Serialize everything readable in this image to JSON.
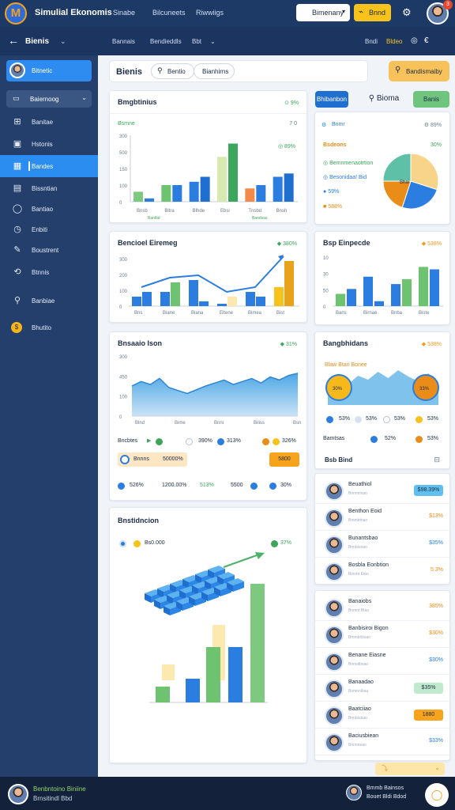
{
  "topbar": {
    "app_title": "Simulial Ekonomis",
    "nav": [
      "Sinabe",
      "Bilcuneets",
      "Riwwiigs"
    ],
    "select_label": "Bimenany",
    "button_label": "Bnnd",
    "notification_count": "3"
  },
  "subbar": {
    "sidebar_title": "Bienis",
    "nav": [
      "Bannais",
      "Bendieddls",
      "Bbt"
    ],
    "right_items": [
      "Bndi",
      "Bldeo",
      "€"
    ]
  },
  "sidebar": {
    "user_label": "Bitnetic",
    "select_label": "Baiernoog",
    "items": [
      {
        "icon": "square-plus-icon",
        "label": "Banitae"
      },
      {
        "icon": "calendar-icon",
        "label": "Hstonis"
      },
      {
        "icon": "chart-icon",
        "label": "Bandes",
        "active": true
      },
      {
        "icon": "document-icon",
        "label": "Bissntian"
      },
      {
        "icon": "circle-icon",
        "label": "Bantiao"
      },
      {
        "icon": "clock-icon",
        "label": "Enbiti"
      },
      {
        "icon": "edit-icon",
        "label": "Boustrent"
      },
      {
        "icon": "support-icon",
        "label": "Btnnis"
      },
      {
        "icon": "user-icon",
        "label": "Banbiae"
      },
      {
        "icon": "dollar-icon",
        "label": "Bhutito"
      }
    ]
  },
  "search": {
    "title": "Bienis",
    "pill1": "Bentio",
    "pill2": "Bianhirns",
    "button": "Bandismaiby"
  },
  "cards": {
    "c1": {
      "title": "Bmgbtinius",
      "badge": "9%",
      "row_left": "Bsmne",
      "row_right": "7 0",
      "badge2": "89%",
      "yticks": [
        "300",
        "500",
        "150",
        "100",
        "0"
      ],
      "xticks": [
        "Bnsb",
        "Bitra",
        "Blhde",
        "Ebsi",
        "Tnsbd",
        "Bnsh"
      ],
      "xsub": [
        "Banibd",
        "Bandsas"
      ]
    },
    "c2": {
      "title": "Bencioel Eiremeg",
      "badge": "380%",
      "yticks": [
        "300",
        "200",
        "100",
        "0"
      ],
      "xticks": [
        "Bns",
        "Biane",
        "Biana",
        "Eltene",
        "Bimea",
        "Bist"
      ]
    },
    "c3": {
      "title": "Bnsaaio Ison",
      "badge": "31%",
      "yticks": [
        "300",
        "450",
        "100",
        "0"
      ],
      "xticks": [
        "Blnd",
        "Bime",
        "Bnni",
        "Biliss",
        "Bsn"
      ],
      "legend1": [
        "Bncbtes",
        "390%",
        "313%",
        "326%"
      ],
      "btn1": "Bnnns",
      "btn1b": "50000%",
      "btn2": "5800",
      "legend2": [
        "526%",
        "1200.00%",
        "513%",
        "5500",
        "30%"
      ]
    },
    "c4": {
      "title": "Bnstidncion",
      "legend": [
        "Bs0.000",
        "37%"
      ]
    },
    "r0": {
      "tabs": [
        "Bhibanbon",
        "Bioma",
        "Banis"
      ]
    },
    "r1": {
      "subtitle": "Bnmr",
      "right": "89%",
      "legend": [
        [
          "Bsdeons",
          "30%"
        ],
        [
          "Bemnmenaotrtion",
          ""
        ],
        [
          "Besonidaa! Bid",
          ""
        ],
        [
          "59%",
          ""
        ],
        [
          "588%",
          ""
        ]
      ],
      "pie_label": "Bhai"
    },
    "r2": {
      "title": "Bsp Einpecde",
      "badge": "538%",
      "yticks": [
        "10",
        "30",
        "50",
        "0"
      ],
      "xticks": [
        "Bans",
        "Birnae",
        "Bnba",
        "Biste"
      ]
    },
    "r3": {
      "title": "Bangbhidans",
      "badge": "538%",
      "subtitle": "Blaw Btan Bonee",
      "l1": [
        "53%",
        "53%",
        "53%"
      ],
      "l2": [
        "Bamtsas",
        "52%",
        "53%"
      ]
    },
    "r4": {
      "header": "Bsb Bind"
    }
  },
  "people1": [
    {
      "name": "Beuathiol",
      "sub": "Bnnnninao",
      "value": "$98.39%",
      "style": "pill-blue"
    },
    {
      "name": "Benthon Eoid",
      "sub": "Bmmbtnao",
      "value": "$13%",
      "style": "orange"
    },
    {
      "name": "Bunantsbao",
      "sub": "Bnnbtsnao",
      "value": "$35%",
      "style": "blue"
    },
    {
      "name": "Bosbla Eonbtion",
      "sub": "Binnbt Etao",
      "value": "5.3%",
      "style": "orange"
    }
  ],
  "people2": [
    {
      "name": "Banaiobs",
      "sub": "Bomnt Btao",
      "value": "385%",
      "style": "orange"
    },
    {
      "name": "Banbisiroi Bigon",
      "sub": "Bmmbhbsao",
      "value": "$30%",
      "style": "orange"
    },
    {
      "name": "Benane Eiasne",
      "sub": "Bnnoitbsao",
      "value": "$30%",
      "style": "blue"
    },
    {
      "name": "Banaadao",
      "sub": "Bomnnibau",
      "value": "$35%",
      "style": "pill-green"
    },
    {
      "name": "Baatciiao",
      "sub": "Bnnbtsbao",
      "value": "1880",
      "style": "pill-orange"
    },
    {
      "name": "Baciusbiean",
      "sub": "Bnnnneao",
      "value": "$33%",
      "style": "blue"
    }
  ],
  "bottombar": {
    "user_line1": "Benbntoino Biniine",
    "user_line2": "Brnsitindl Bbd",
    "right_line1": "Bmmb Bainsos",
    "right_line2": "Bouet Bldi Bdod"
  },
  "chart_data": [
    {
      "type": "bar",
      "title": "Bmgbtinius",
      "categories": [
        "Bnsb",
        "Bitra",
        "Blhde",
        "Ebsi",
        "Tnsbd",
        "Bnsh"
      ],
      "series": [
        {
          "values": [
            60,
            100,
            120,
            270,
            80,
            150
          ]
        },
        {
          "values": [
            20,
            100,
            150,
            350,
            100,
            170
          ]
        }
      ],
      "ylim": [
        0,
        400
      ]
    },
    {
      "type": "bar",
      "title": "Bencioel Eiremeg",
      "categories": [
        "Bns",
        "Biane",
        "Biana",
        "Eltene",
        "Bimea",
        "Bist"
      ],
      "series": [
        {
          "values": [
            40,
            60,
            110,
            10,
            60,
            80
          ]
        },
        {
          "values": [
            60,
            100,
            20,
            40,
            40,
            190
          ]
        }
      ],
      "ylim": [
        0,
        200
      ]
    },
    {
      "type": "area",
      "title": "Bnsaaio Ison",
      "x": [
        "Blnd",
        "Bime",
        "Bnni",
        "Biliss",
        "Bsn"
      ],
      "y": [
        180,
        240,
        170,
        220,
        280
      ],
      "ylim": [
        0,
        400
      ]
    },
    {
      "type": "pie",
      "values": [
        30,
        25,
        20,
        25
      ]
    },
    {
      "type": "bar",
      "title": "Bsp Einpecde",
      "categories": [
        "Bans",
        "Birnae",
        "Bnba",
        "Biste"
      ],
      "series": [
        {
          "values": [
            25,
            60,
            45,
            80
          ]
        },
        {
          "values": [
            35,
            10,
            55,
            75
          ]
        }
      ],
      "ylim": [
        0,
        100
      ]
    },
    {
      "type": "bar",
      "title": "Bnstidncion",
      "values": [
        20,
        30,
        70,
        70,
        150
      ]
    }
  ]
}
